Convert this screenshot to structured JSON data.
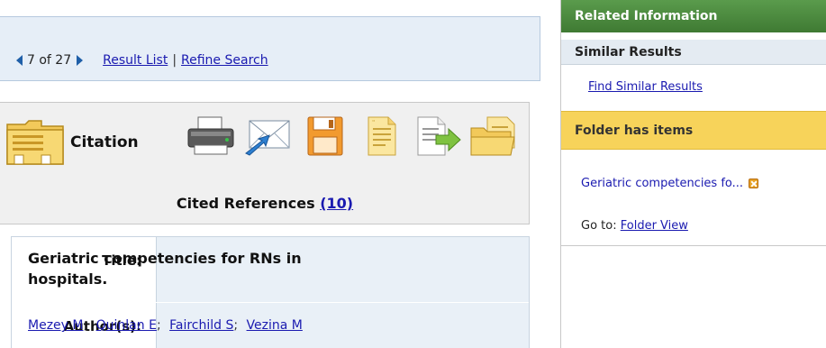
{
  "navigation": {
    "position": "7 of 27",
    "result_list": "Result List",
    "separator": "|",
    "refine_search": "Refine Search"
  },
  "toolbar": {
    "citation_label": "Citation",
    "icons": [
      "printer-icon",
      "email-icon",
      "save-icon",
      "cite-icon",
      "export-icon",
      "add-to-folder-icon"
    ],
    "cited_references_label": "Cited References",
    "cited_references_count": "(10)"
  },
  "record": {
    "title_label": "Title:",
    "title_value": "Geriatric competencies for RNs in hospitals.",
    "authors_label": "Author(s):",
    "authors": [
      "Mezey M",
      "Quinlan E",
      "Fairchild S",
      "Vezina M"
    ],
    "author_separator": ";"
  },
  "sidebar": {
    "header": "Related Information",
    "similar_results_heading": "Similar Results",
    "find_similar_link": "Find Similar Results",
    "folder_heading": "Folder has items",
    "folder_item": "Geriatric competencies fo...",
    "goto_label": "Go to:",
    "folder_view_link": "Folder View"
  },
  "colors": {
    "link": "#1a1ab0",
    "sidebar_header_green": "#4a8a3e",
    "folder_yellow": "#f7d35a",
    "nav_bg": "#e6eef7"
  }
}
